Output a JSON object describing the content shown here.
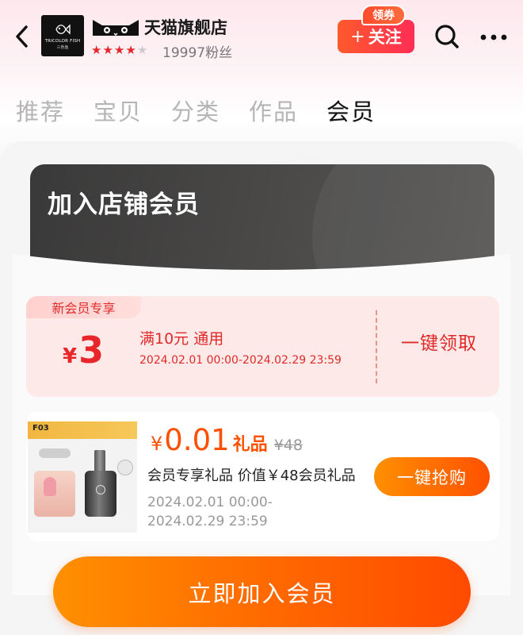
{
  "header": {
    "store_name": "天猫旗舰店",
    "logo_text": "TRICOLOR FISH",
    "logo_subtext": "三色鱼",
    "stars_filled": 4,
    "stars_total": 5,
    "fans": "19997粉丝",
    "follow_label": "关注",
    "coupon_tag": "领券",
    "icons": {
      "back": "chevron-left-icon",
      "search": "search-icon",
      "more": "more-icon",
      "brand": "tmall-cat-icon"
    }
  },
  "tabs": [
    {
      "label": "推荐",
      "active": false
    },
    {
      "label": "宝贝",
      "active": false
    },
    {
      "label": "分类",
      "active": false
    },
    {
      "label": "作品",
      "active": false
    },
    {
      "label": "会员",
      "active": true
    }
  ],
  "member": {
    "title": "加入店铺会员",
    "coupon": {
      "badge": "新会员专享",
      "currency": "¥",
      "amount": "3",
      "condition": "满10元 通用",
      "validity": "2024.02.01 00:00-2024.02.29 23:59",
      "action": "一键领取"
    },
    "gift": {
      "currency": "¥",
      "price": "0.01",
      "price_label": "礼品",
      "original_price": "¥48",
      "title": "会员专享礼品 价值￥48会员礼品",
      "start": "2024.02.01 00:00-",
      "end": "2024.02.29 23:59",
      "action": "一键抢购",
      "image_text": "F03"
    },
    "join_label": "立即加入会员"
  },
  "colors": {
    "accent_red": "#e02a2a",
    "accent_orange": "#ff5000",
    "star": "#e8262a",
    "dark_card": "#454443"
  }
}
